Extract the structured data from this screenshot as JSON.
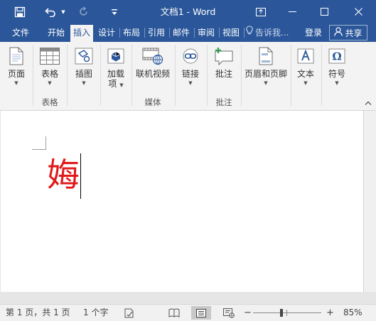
{
  "titlebar": {
    "title": "文档1 - Word",
    "save_icon": "save-icon",
    "undo_icon": "undo-icon",
    "redo_icon": "redo-icon",
    "customize_icon": "customize-quick-access-icon"
  },
  "tabs": [
    {
      "label": "文件"
    },
    {
      "label": "开始"
    },
    {
      "label": "插入",
      "active": true
    },
    {
      "label": "设计"
    },
    {
      "label": "布局"
    },
    {
      "label": "引用"
    },
    {
      "label": "邮件"
    },
    {
      "label": "审阅"
    },
    {
      "label": "视图"
    }
  ],
  "tellme": {
    "placeholder": "告诉我..."
  },
  "login_label": "登录",
  "share_label": "共享",
  "ribbon": {
    "buttons": {
      "pages": "页面",
      "table": "表格",
      "illustrations": "插图",
      "addins_line1": "加载",
      "addins_line2": "项",
      "online_video": "联机视频",
      "link": "链接",
      "comment": "批注",
      "header_footer": "页眉和页脚",
      "text": "文本",
      "symbols": "符号"
    },
    "groups": {
      "table": "表格",
      "media": "媒体",
      "comments": "批注"
    }
  },
  "document": {
    "text": "娒",
    "text_color": "#e0191a"
  },
  "statusbar": {
    "page_info": "第 1 页，共 1 页",
    "word_count": "1 个字",
    "zoom": "85%",
    "zoom_minus": "−",
    "zoom_plus": "+"
  },
  "colors": {
    "accent": "#2b579a",
    "ribbon_bg": "#f3f3f3",
    "workspace_bg": "#e6e6e6"
  }
}
